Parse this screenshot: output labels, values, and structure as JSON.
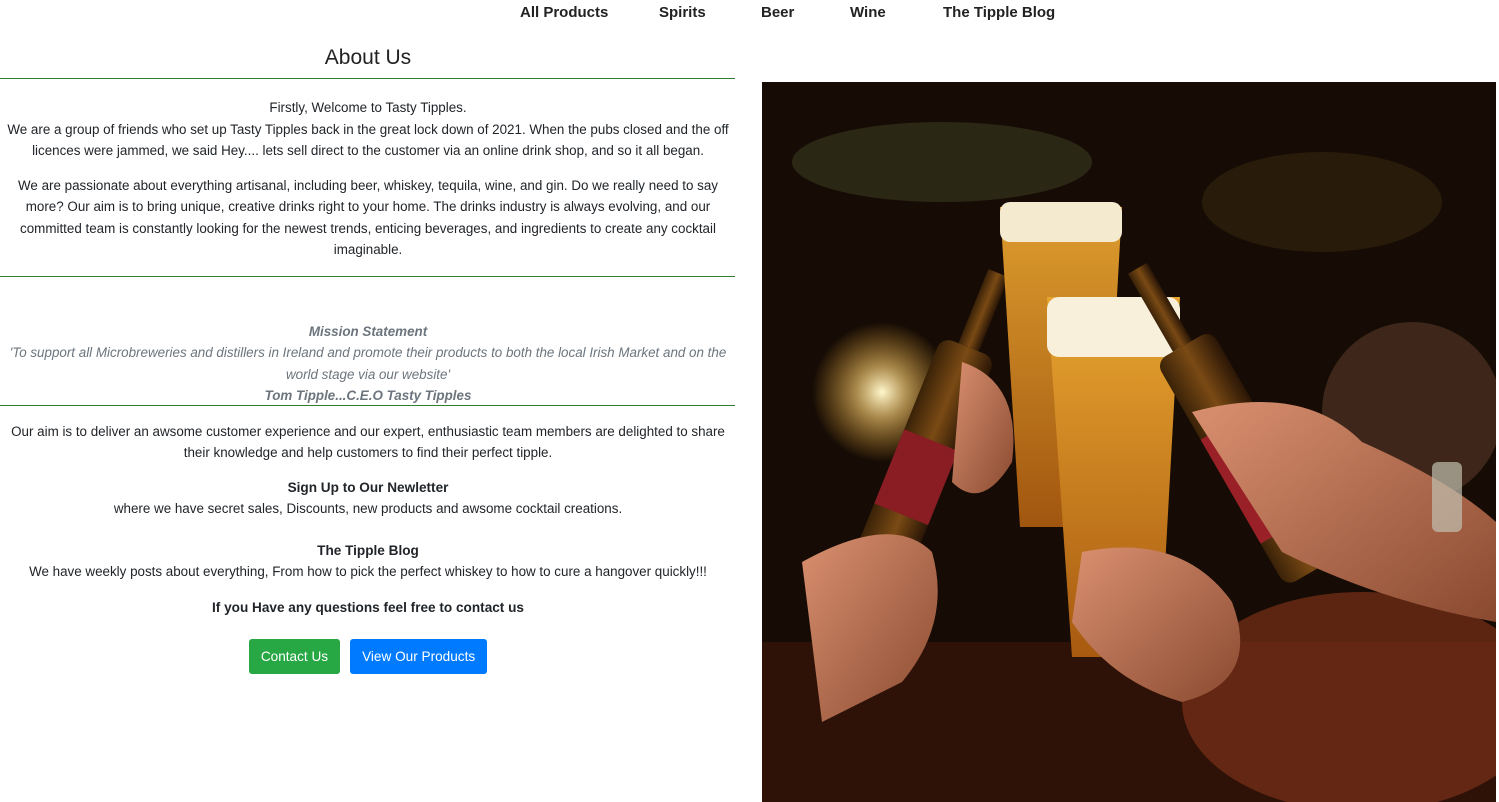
{
  "nav": {
    "items": [
      "All Products",
      "Spirits",
      "Beer",
      "Wine",
      "The Tipple Blog"
    ]
  },
  "about": {
    "title": "About Us",
    "welcome": "Firstly, Welcome to Tasty Tipples.",
    "intro": "We are a group of friends who set up Tasty Tipples back in the great lock down of 2021. When the pubs closed and the off licences were jammed, we said Hey.... lets sell direct to the customer via an online drink shop, and so it all began.",
    "passion": "We are passionate about everything artisanal, including beer, whiskey, tequila, wine, and gin. Do we really need to say more? Our aim is to bring unique, creative drinks right to your home. The drinks industry is always evolving, and our committed team is constantly looking for the newest trends, enticing beverages, and ingredients to create any cocktail imaginable."
  },
  "mission": {
    "heading": "Mission Statement",
    "quote": "'To support all Microbreweries and distillers in Ireland and promote their products to both the local Irish Market and on the world stage via our website'",
    "author": "Tom Tipple...C.E.O Tasty Tipples"
  },
  "aim": "Our aim is to deliver an awsome customer experience and our expert, enthusiastic team members are delighted to share their knowledge and help customers to find their perfect tipple.",
  "newsletter": {
    "heading": "Sign Up to Our Newletter",
    "text": "where we have secret sales, Discounts, new products and awsome cocktail creations."
  },
  "blog": {
    "heading": "The Tipple Blog",
    "text": "We have weekly posts about everything, From how to pick the perfect whiskey to how to cure a hangover quickly!!!"
  },
  "contact_prompt": "If you Have any questions feel free to contact us",
  "buttons": {
    "contact": "Contact Us",
    "products": "View Our Products"
  },
  "colors": {
    "divider": "#2e7d32",
    "contact_button": "#28a745",
    "products_button": "#007bff",
    "mission_text": "#6c757d"
  }
}
